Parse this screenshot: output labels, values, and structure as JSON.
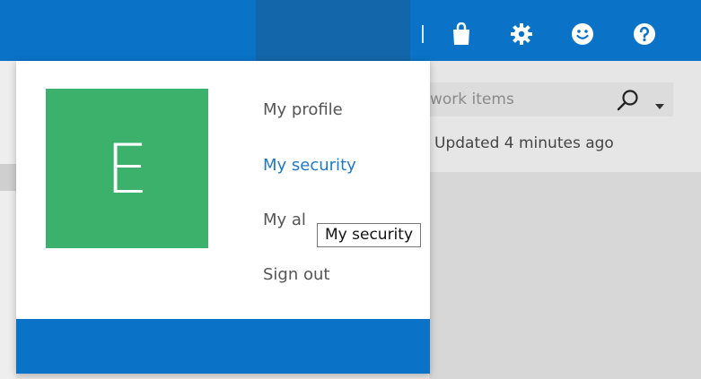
{
  "colors": {
    "topbar": "#0a73c8",
    "topbar_active": "#1366a9",
    "avatar": "#3bb16c",
    "link_active": "#1f78c8"
  },
  "topbar": {
    "icons": [
      "shopping-bag-icon",
      "gear-icon",
      "smiley-icon",
      "help-icon"
    ]
  },
  "search": {
    "placeholder": "work items"
  },
  "status": {
    "updated": "Updated 4 minutes ago"
  },
  "profile": {
    "avatar_initial": "E",
    "menu": [
      {
        "label": "My profile",
        "active": false
      },
      {
        "label": "My security",
        "active": true
      },
      {
        "label": "My al",
        "active": false
      },
      {
        "label": "Sign out",
        "active": false
      }
    ]
  },
  "tooltip": {
    "text": "My security"
  }
}
